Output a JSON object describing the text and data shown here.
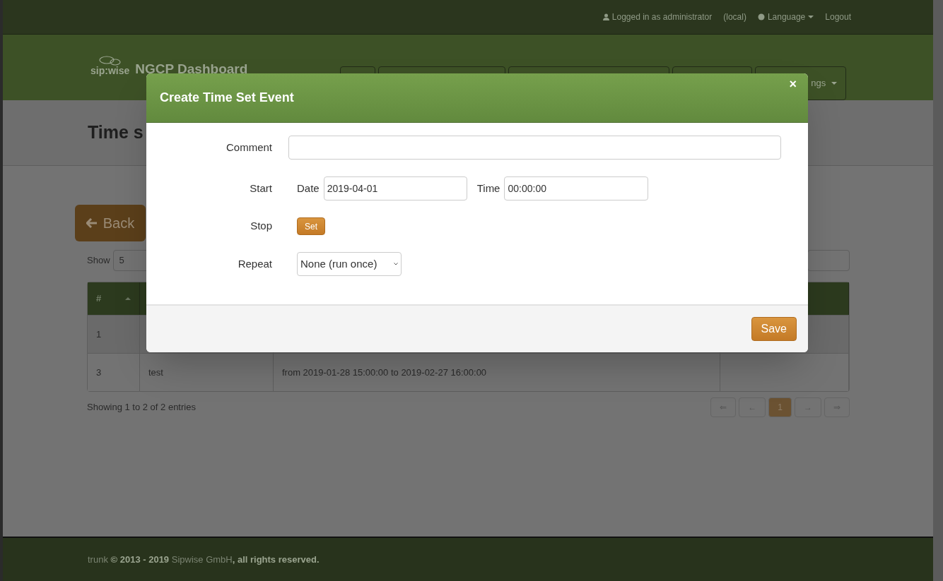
{
  "top_bar": {
    "user": "Logged in as administrator",
    "realm": "(local)",
    "language": "Language",
    "logout": "Logout"
  },
  "header": {
    "logo_mark": "sip:wise",
    "title": "NGCP Dashboard",
    "nav_items": [
      {
        "kind": "blank"
      },
      {
        "kind": "blank"
      },
      {
        "kind": "blank"
      },
      {
        "kind": "blank"
      },
      {
        "kind": "labeled",
        "label": "ngs"
      }
    ]
  },
  "page_title": "Time s",
  "back_button": "Back",
  "length_menu": {
    "label": "Show",
    "value": "5"
  },
  "table": {
    "columns": [
      "#"
    ],
    "rows": [
      {
        "cells": [
          "1"
        ]
      },
      {
        "cells": [
          "3",
          "test",
          "from 2019-01-28 15:00:00 to 2019-02-27 16:00:00"
        ]
      }
    ]
  },
  "table_info": "Showing 1 to 2 of 2 entries",
  "pagination": [
    {
      "label": "⇐",
      "selected": false
    },
    {
      "label": "←",
      "selected": false
    },
    {
      "label": "1",
      "selected": true
    },
    {
      "label": "→",
      "selected": false
    },
    {
      "label": "⇒",
      "selected": false
    }
  ],
  "footer": {
    "build": "trunk",
    "copyright": "© 2013 - 2019",
    "company": "Sipwise GmbH",
    "rights": ", all rights reserved."
  },
  "modal": {
    "title": "Create Time Set Event",
    "close": "×",
    "fields": [
      {
        "kind": "text",
        "label": "Comment"
      },
      {
        "kind": "datetime",
        "label": "Start",
        "date_label": "Date",
        "date": "2019-04-01",
        "time_label": "Time",
        "time": "00:00:00"
      },
      {
        "kind": "button",
        "label": "Stop",
        "button": "Set"
      },
      {
        "kind": "select",
        "label": "Repeat",
        "value": "None (run once)"
      }
    ],
    "save": "Save"
  }
}
